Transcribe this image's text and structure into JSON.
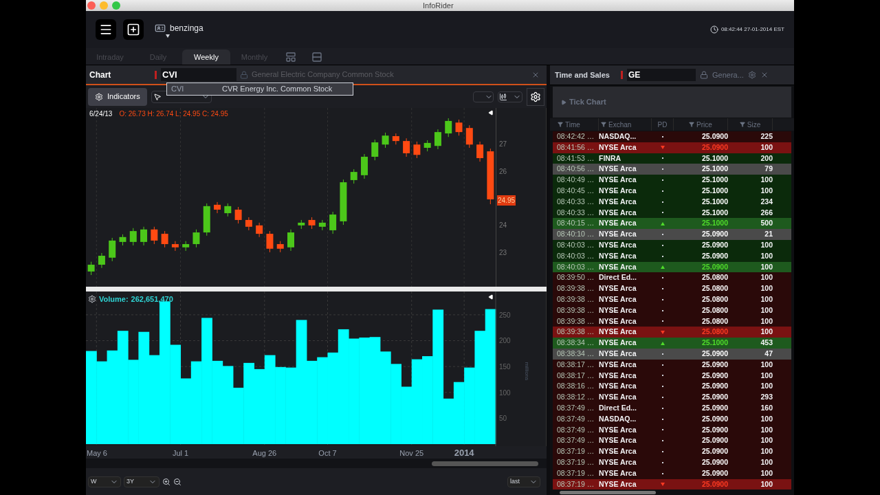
{
  "window": {
    "title": "InfoRider"
  },
  "toolbar": {
    "user": "benzinga",
    "clock": "08:42:44 27-01-2014 EST"
  },
  "period_tabs": [
    {
      "label": "Intraday",
      "selected": false
    },
    {
      "label": "Daily",
      "selected": false
    },
    {
      "label": "Weekly",
      "selected": true
    },
    {
      "label": "Monthly",
      "selected": false
    }
  ],
  "chart_panel": {
    "title": "Chart",
    "symbol": "CVI",
    "description": "General Electric Company Common Stock",
    "autocomplete": {
      "symbol": "CVI",
      "name": "CVR Energy Inc. Common Stock"
    },
    "indicators_button": "Indicators",
    "ohlc_date": "6/24/13",
    "ohlc": "O: 26.73 H: 26.74 L: 24.95 C: 24.95",
    "price_chart": {
      "chart_data": {
        "type": "candlestick",
        "grid": true,
        "ylim": [
          21.73,
          28.32
        ],
        "yticks": [
          23,
          24,
          26,
          27
        ],
        "ohlc": [
          [
            22.29,
            22.65,
            22.16,
            22.54
          ],
          [
            22.54,
            22.97,
            22.42,
            22.87
          ],
          [
            22.8,
            23.53,
            22.67,
            23.43
          ],
          [
            23.38,
            23.66,
            23.25,
            23.56
          ],
          [
            23.38,
            23.89,
            23.25,
            23.78
          ],
          [
            23.38,
            23.94,
            23.25,
            23.84
          ],
          [
            23.84,
            23.94,
            23.3,
            23.43
          ],
          [
            23.68,
            23.78,
            23.18,
            23.3
          ],
          [
            23.3,
            23.41,
            23.05,
            23.18
          ],
          [
            23.18,
            23.41,
            23.05,
            23.3
          ],
          [
            23.3,
            23.84,
            23.18,
            23.73
          ],
          [
            23.73,
            24.8,
            23.61,
            24.7
          ],
          [
            24.75,
            24.85,
            24.44,
            24.57
          ],
          [
            24.44,
            24.8,
            24.32,
            24.7
          ],
          [
            24.57,
            24.67,
            24.06,
            24.19
          ],
          [
            24.19,
            24.29,
            23.81,
            23.94
          ],
          [
            23.99,
            24.09,
            23.56,
            23.68
          ],
          [
            23.68,
            23.78,
            23.0,
            23.13
          ],
          [
            23.3,
            23.41,
            23.0,
            23.13
          ],
          [
            23.18,
            23.84,
            23.05,
            23.73
          ],
          [
            23.99,
            24.19,
            23.86,
            24.09
          ],
          [
            24.19,
            24.29,
            23.86,
            23.99
          ],
          [
            23.94,
            24.19,
            23.81,
            24.09
          ],
          [
            23.81,
            24.49,
            23.68,
            24.39
          ],
          [
            24.14,
            25.68,
            24.01,
            25.58
          ],
          [
            25.66,
            26.06,
            25.53,
            25.96
          ],
          [
            25.84,
            26.62,
            25.71,
            26.52
          ],
          [
            26.52,
            27.15,
            26.39,
            27.05
          ],
          [
            26.97,
            27.41,
            26.85,
            27.3
          ],
          [
            27.28,
            27.38,
            26.97,
            27.1
          ],
          [
            27.1,
            27.2,
            26.52,
            26.65
          ],
          [
            26.97,
            27.08,
            26.47,
            26.59
          ],
          [
            26.85,
            27.13,
            26.72,
            27.03
          ],
          [
            26.92,
            27.53,
            26.8,
            27.43
          ],
          [
            27.38,
            27.94,
            27.25,
            27.84
          ],
          [
            27.78,
            27.89,
            27.3,
            27.43
          ],
          [
            27.58,
            27.68,
            26.85,
            26.97
          ],
          [
            26.97,
            27.08,
            26.34,
            26.47
          ],
          [
            26.72,
            26.82,
            24.77,
            24.95
          ]
        ]
      }
    },
    "last_price": "24.95",
    "volume_label": "Volume:",
    "volume_value": "262,651,470",
    "volume_chart": {
      "chart_data": {
        "type": "bar",
        "grid": true,
        "ylabel": "millions",
        "ylim": [
          0,
          295
        ],
        "yticks": [
          50,
          100,
          150,
          200,
          250
        ],
        "values": [
          180,
          160,
          181,
          219,
          163,
          217,
          172,
          276,
          192,
          127,
          160,
          244,
          161,
          151,
          109,
          157,
          145,
          172,
          149,
          148,
          240,
          161,
          168,
          177,
          222,
          204,
          206,
          207,
          179,
          155,
          111,
          164,
          170,
          260,
          88,
          120,
          148,
          219,
          261
        ]
      }
    },
    "date_labels": [
      "May 6",
      "Jul 1",
      "Aug 26",
      "Oct 7",
      "Nov 25",
      "2014"
    ],
    "interval": "W",
    "range": "3Y",
    "price_type": "last"
  },
  "time_and_sales": {
    "title": "Time and Sales",
    "symbol": "GE",
    "description": "Genera...",
    "tick_chart": "Tick Chart",
    "columns": [
      {
        "label": "Time",
        "filter": true
      },
      {
        "label": "Exchan",
        "filter": true
      },
      {
        "label": "PD",
        "filter": false
      },
      {
        "label": "Price",
        "filter": true
      },
      {
        "label": "Size",
        "filter": true
      }
    ],
    "rows": [
      {
        "time": "08:42:42 …",
        "exchange": "NASDAQ...",
        "uptick": false,
        "downtick": false,
        "color": "#2a0909",
        "price": "25.0900",
        "size": "225"
      },
      {
        "time": "08:41:56 …",
        "exchange": "NYSE Arca",
        "uptick": false,
        "downtick": true,
        "color": "#7a1212",
        "price": "25.0900",
        "size": "100"
      },
      {
        "time": "08:41:53 …",
        "exchange": "FINRA",
        "uptick": false,
        "downtick": false,
        "color": "#0b2a0b",
        "price": "25.1000",
        "size": "200"
      },
      {
        "time": "08:40:56 …",
        "exchange": "NYSE Arca",
        "uptick": false,
        "downtick": false,
        "color": "#4a4a4a",
        "price": "25.1000",
        "size": "79"
      },
      {
        "time": "08:40:49 …",
        "exchange": "NYSE Arca",
        "uptick": false,
        "downtick": false,
        "color": "#0b2a0b",
        "price": "25.1000",
        "size": "100"
      },
      {
        "time": "08:40:45 …",
        "exchange": "NYSE Arca",
        "uptick": false,
        "downtick": false,
        "color": "#0b2a0b",
        "price": "25.1000",
        "size": "100"
      },
      {
        "time": "08:40:33 …",
        "exchange": "NYSE Arca",
        "uptick": false,
        "downtick": false,
        "color": "#0b2a0b",
        "price": "25.1000",
        "size": "234"
      },
      {
        "time": "08:40:33 …",
        "exchange": "NYSE Arca",
        "uptick": false,
        "downtick": false,
        "color": "#0b2a0b",
        "price": "25.1000",
        "size": "266"
      },
      {
        "time": "08:40:15 …",
        "exchange": "NYSE Arca",
        "uptick": true,
        "downtick": false,
        "color": "#1e5a1e",
        "price": "25.1000",
        "size": "500"
      },
      {
        "time": "08:40:10 …",
        "exchange": "NYSE Arca",
        "uptick": false,
        "downtick": false,
        "color": "#4a4a4a",
        "price": "25.0900",
        "size": "21"
      },
      {
        "time": "08:40:03 …",
        "exchange": "NYSE Arca",
        "uptick": false,
        "downtick": false,
        "color": "#0b2a0b",
        "price": "25.0900",
        "size": "100"
      },
      {
        "time": "08:40:03 …",
        "exchange": "NYSE Arca",
        "uptick": false,
        "downtick": false,
        "color": "#0b2a0b",
        "price": "25.0900",
        "size": "100"
      },
      {
        "time": "08:40:03 …",
        "exchange": "NYSE Arca",
        "uptick": true,
        "downtick": false,
        "color": "#1e5a1e",
        "price": "25.0900",
        "size": "100"
      },
      {
        "time": "08:39:50 …",
        "exchange": "Direct Ed...",
        "uptick": false,
        "downtick": false,
        "color": "#2a0909",
        "price": "25.0800",
        "size": "100"
      },
      {
        "time": "08:39:38 …",
        "exchange": "NYSE Arca",
        "uptick": false,
        "downtick": false,
        "color": "#2a0909",
        "price": "25.0800",
        "size": "100"
      },
      {
        "time": "08:39:38 …",
        "exchange": "NYSE Arca",
        "uptick": false,
        "downtick": false,
        "color": "#2a0909",
        "price": "25.0800",
        "size": "100"
      },
      {
        "time": "08:39:38 …",
        "exchange": "NYSE Arca",
        "uptick": false,
        "downtick": false,
        "color": "#2a0909",
        "price": "25.0800",
        "size": "100"
      },
      {
        "time": "08:39:38 …",
        "exchange": "NYSE Arca",
        "uptick": false,
        "downtick": false,
        "color": "#2a0909",
        "price": "25.0800",
        "size": "100"
      },
      {
        "time": "08:39:38 …",
        "exchange": "NYSE Arca",
        "uptick": false,
        "downtick": true,
        "color": "#7a1212",
        "price": "25.0800",
        "size": "100"
      },
      {
        "time": "08:38:34 …",
        "exchange": "NYSE Arca",
        "uptick": true,
        "downtick": false,
        "color": "#1e5a1e",
        "price": "25.1000",
        "size": "453"
      },
      {
        "time": "08:38:34 …",
        "exchange": "NYSE Arca",
        "uptick": false,
        "downtick": false,
        "color": "#4a4a4a",
        "price": "25.0900",
        "size": "47"
      },
      {
        "time": "08:38:17 …",
        "exchange": "NYSE Arca",
        "uptick": false,
        "downtick": false,
        "color": "#2a0909",
        "price": "25.0900",
        "size": "100"
      },
      {
        "time": "08:38:17 …",
        "exchange": "NYSE Arca",
        "uptick": false,
        "downtick": false,
        "color": "#2a0909",
        "price": "25.0900",
        "size": "100"
      },
      {
        "time": "08:38:16 …",
        "exchange": "NYSE Arca",
        "uptick": false,
        "downtick": false,
        "color": "#2a0909",
        "price": "25.0900",
        "size": "100"
      },
      {
        "time": "08:38:12 …",
        "exchange": "NYSE Arca",
        "uptick": false,
        "downtick": false,
        "color": "#2a0909",
        "price": "25.0900",
        "size": "293"
      },
      {
        "time": "08:37:49 …",
        "exchange": "Direct Ed...",
        "uptick": false,
        "downtick": false,
        "color": "#2a0909",
        "price": "25.0900",
        "size": "160"
      },
      {
        "time": "08:37:49 …",
        "exchange": "NASDAQ...",
        "uptick": false,
        "downtick": false,
        "color": "#2a0909",
        "price": "25.0900",
        "size": "100"
      },
      {
        "time": "08:37:49 …",
        "exchange": "NYSE Arca",
        "uptick": false,
        "downtick": false,
        "color": "#2a0909",
        "price": "25.0900",
        "size": "100"
      },
      {
        "time": "08:37:49 …",
        "exchange": "NYSE Arca",
        "uptick": false,
        "downtick": false,
        "color": "#2a0909",
        "price": "25.0900",
        "size": "100"
      },
      {
        "time": "08:37:19 …",
        "exchange": "NYSE Arca",
        "uptick": false,
        "downtick": false,
        "color": "#2a0909",
        "price": "25.0900",
        "size": "100"
      },
      {
        "time": "08:37:19 …",
        "exchange": "NYSE Arca",
        "uptick": false,
        "downtick": false,
        "color": "#2a0909",
        "price": "25.0900",
        "size": "100"
      },
      {
        "time": "08:37:19 …",
        "exchange": "NYSE Arca",
        "uptick": false,
        "downtick": false,
        "color": "#2a0909",
        "price": "25.0900",
        "size": "100"
      },
      {
        "time": "08:37:19 …",
        "exchange": "NYSE Arca",
        "uptick": false,
        "downtick": true,
        "color": "#7a1212",
        "price": "25.0900",
        "size": "100"
      }
    ]
  }
}
